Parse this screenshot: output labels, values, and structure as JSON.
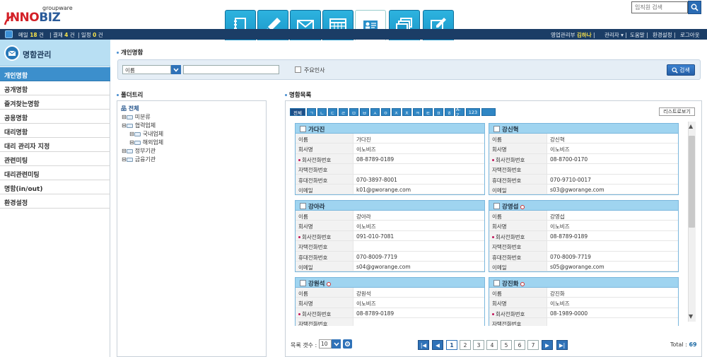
{
  "header": {
    "logo_top": "groupware",
    "logo_red": "INNO",
    "logo_blue": "BIZ",
    "search_placeholder": "임직원 검색"
  },
  "nav_tabs": [
    {
      "name": "notebook-icon",
      "active": false
    },
    {
      "name": "pen-icon",
      "active": false
    },
    {
      "name": "mail-icon",
      "active": false
    },
    {
      "name": "calendar-icon",
      "active": false
    },
    {
      "name": "namecard-icon",
      "active": true
    },
    {
      "name": "windows-icon",
      "active": false
    },
    {
      "name": "edit-icon",
      "active": false
    }
  ],
  "topbar": {
    "mail_label": "메일",
    "mail_count": "18",
    "mail_unit": "건",
    "approval_label": "결재",
    "approval_count": "4",
    "approval_unit": "건",
    "schedule_label": "일정",
    "schedule_count": "0",
    "schedule_unit": "건",
    "dept": "영업관리부",
    "user": "김하나",
    "admin": "관리자",
    "help": "도움말",
    "settings": "환경설정",
    "logout": "로그아웃"
  },
  "sidebar": {
    "title": "명함관리",
    "items": [
      {
        "label": "개인명함",
        "active": true
      },
      {
        "label": "공개명함"
      },
      {
        "label": "즐겨찾는명함"
      },
      {
        "label": "공용명함"
      },
      {
        "label": "대리명함"
      },
      {
        "label": "대리 관리자 지정"
      },
      {
        "label": "관련미팅"
      },
      {
        "label": "대리관련미팅"
      },
      {
        "label": "명함(in/out)"
      },
      {
        "label": "환경설정"
      }
    ]
  },
  "main": {
    "section_title": "개인명함",
    "filter": {
      "field": "이름",
      "checkbox_label": "주요인사",
      "search_btn": "검색"
    },
    "tree_title": "폴더트리",
    "tree": {
      "root": "전체",
      "n1": "미분류",
      "n2": "협력업체",
      "n2a": "국내업체",
      "n2b": "해외업체",
      "n3": "정부기관",
      "n4": "금융기관"
    },
    "list_title": "명함목록",
    "alpha_filters": [
      "전체",
      "ㄱ",
      "ㄴ",
      "ㄷ",
      "ㄹ",
      "ㅁ",
      "ㅂ",
      "ㅅ",
      "ㅇ",
      "ㅈ",
      "ㅊ",
      "ㅋ",
      "ㅌ",
      "ㅍ",
      "ㅎ",
      "A-Z",
      "123"
    ],
    "list_view_btn": "리스트로보기",
    "field_labels": {
      "name": "이름",
      "company": "회사명",
      "office_phone": "회사전화번호",
      "home_phone": "자택전화번호",
      "mobile": "휴대전화번호",
      "email": "이메일"
    },
    "cards": [
      {
        "title": "가다진",
        "lock": false,
        "name": "가다진",
        "company": "이노비즈",
        "office_phone": "08-8789-0189",
        "home_phone": "",
        "mobile": "070-3897-8001",
        "email": "k01@gworange.com"
      },
      {
        "title": "강신혁",
        "lock": false,
        "name": "강신혁",
        "company": "이노비즈",
        "office_phone": "08-8700-0170",
        "home_phone": "",
        "mobile": "070-9710-0017",
        "email": "s03@gworange.com"
      },
      {
        "title": "강아라",
        "lock": false,
        "name": "강아라",
        "company": "이노비즈",
        "office_phone": "091-010-7081",
        "home_phone": "",
        "mobile": "070-8009-7719",
        "email": "s04@gworange.com"
      },
      {
        "title": "강영섭",
        "lock": true,
        "name": "강영섭",
        "company": "이노비즈",
        "office_phone": "08-8789-0189",
        "home_phone": "",
        "mobile": "070-8009-7719",
        "email": "s05@gworange.com"
      },
      {
        "title": "강원석",
        "lock": true,
        "name": "강원석",
        "company": "이노비즈",
        "office_phone": "08-8789-0189",
        "home_phone": "",
        "mobile": "",
        "email": ""
      },
      {
        "title": "강진화",
        "lock": true,
        "name": "강진화",
        "company": "이노비즈",
        "office_phone": "08-1989-0000",
        "home_phone": "",
        "mobile": "",
        "email": ""
      }
    ],
    "pagination": {
      "count_label": "목록 갯수 :",
      "count_value": "10",
      "pages": [
        "1",
        "2",
        "3",
        "4",
        "5",
        "6",
        "7"
      ],
      "current": "1",
      "total_label": "Total :",
      "total_value": "69"
    }
  }
}
